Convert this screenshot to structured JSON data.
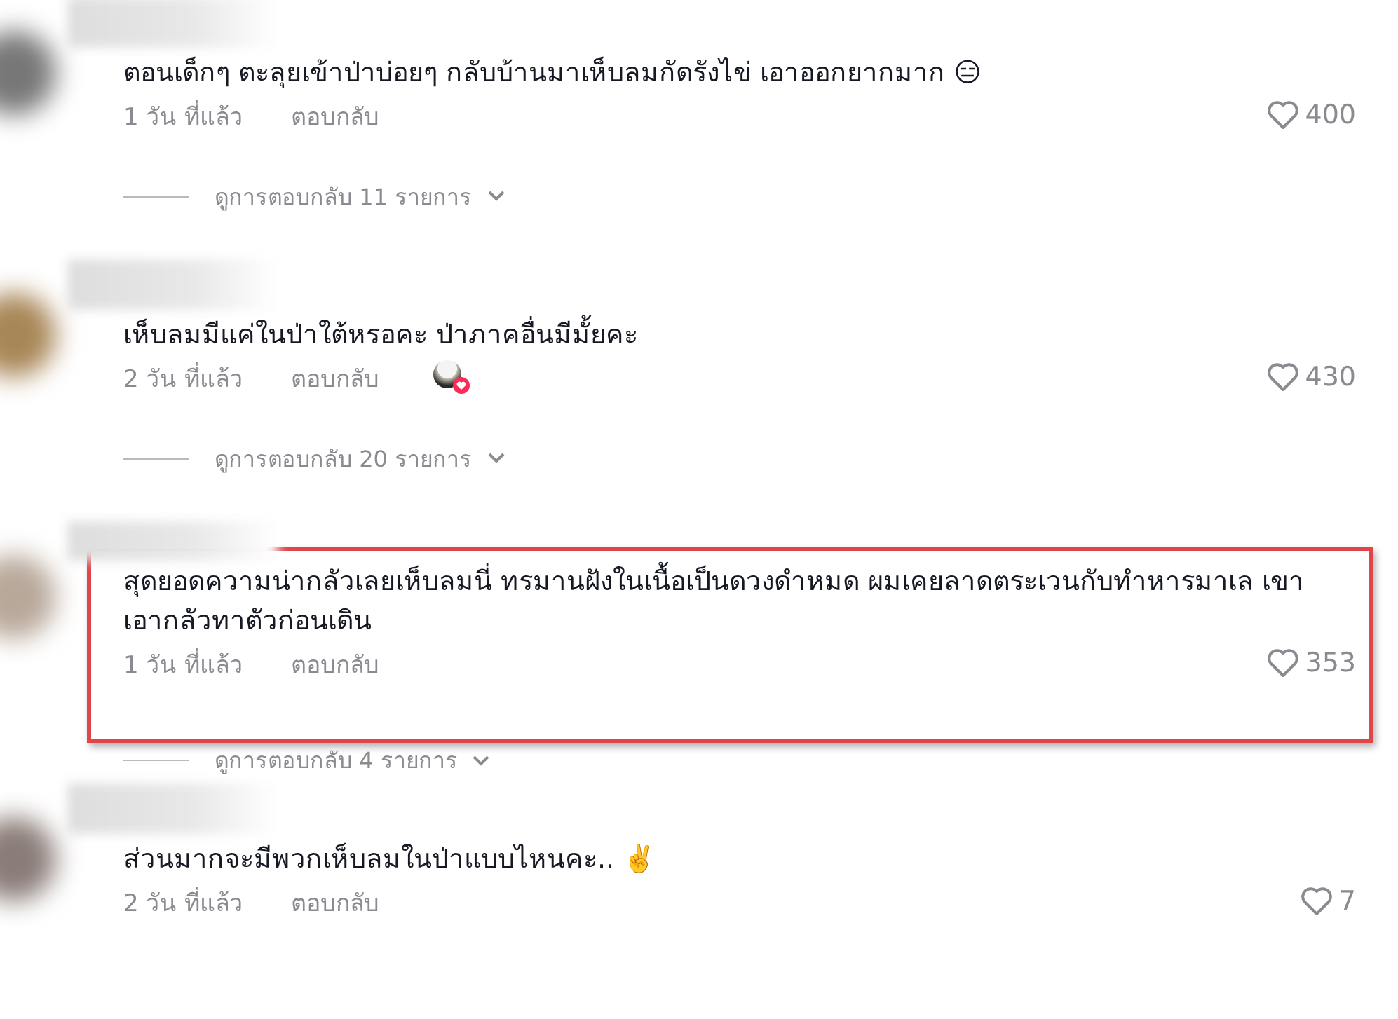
{
  "comments": [
    {
      "text": "ตอนเด็กๆ ตะลุยเข้าป่าบ่อยๆ กลับบ้านมาเห็บลมกัดรังไข่ เอาออกยากมาก 😑",
      "time": "1 วัน ที่แล้ว",
      "reply": "ตอบกลับ",
      "likes": "400",
      "liked_by_creator": false,
      "highlighted": false,
      "replies": "ดูการตอบกลับ 11 รายการ"
    },
    {
      "text": "เห็บลมมีแค่ในป่าใต้หรอคะ ป่าภาคอื่นมีมั้ยคะ",
      "time": "2 วัน ที่แล้ว",
      "reply": "ตอบกลับ",
      "likes": "430",
      "liked_by_creator": true,
      "highlighted": false,
      "replies": "ดูการตอบกลับ 20 รายการ"
    },
    {
      "text": "สุดยอดความน่ากลัวเลยเห็บลมนี่ ทรมานฝังในเนื้อเป็นดวงดำหมด ผมเคยลาดตระเวนกับทำหารมาเล เขาเอากลัวทาตัวก่อนเดิน",
      "time": "1 วัน ที่แล้ว",
      "reply": "ตอบกลับ",
      "likes": "353",
      "liked_by_creator": false,
      "highlighted": true,
      "replies": "ดูการตอบกลับ 4 รายการ"
    },
    {
      "text": "ส่วนมากจะมีพวกเห็บลมในป่าแบบไหนคะ.. ✌️",
      "time": "2 วัน ที่แล้ว",
      "reply": "ตอบกลับ",
      "likes": "7",
      "liked_by_creator": false,
      "highlighted": false
    }
  ]
}
